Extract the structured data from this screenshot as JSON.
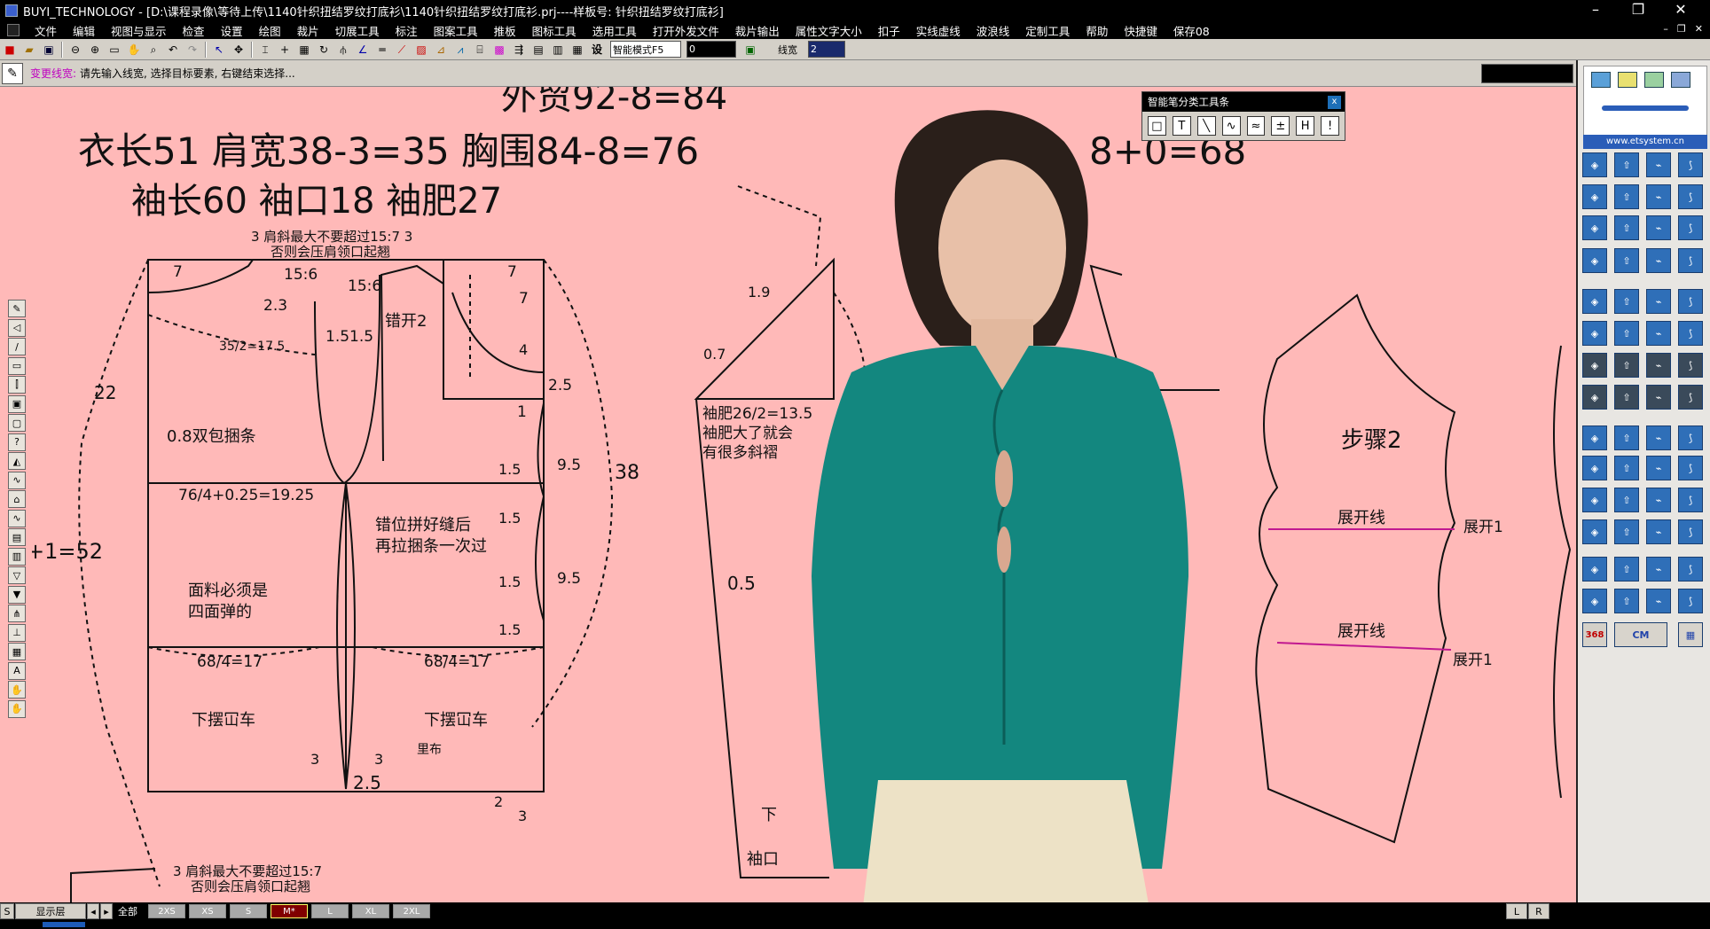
{
  "window": {
    "title": "BUYI_TECHNOLOGY - [D:\\课程录像\\等待上传\\1140针织扭结罗纹打底衫\\1140针织扭结罗纹打底衫.prj----样板号: 针织扭结罗纹打底衫]",
    "controls": {
      "minimize": "–",
      "maximize": "❐",
      "close": "✕"
    }
  },
  "menu": {
    "items": [
      "文件",
      "编辑",
      "视图与显示",
      "检查",
      "设置",
      "绘图",
      "裁片",
      "切展工具",
      "标注",
      "图案工具",
      "推板",
      "图标工具",
      "选用工具",
      "打开外发文件",
      "裁片输出",
      "属性文字大小",
      "扣子",
      "实线虚线",
      "波浪线",
      "定制工具",
      "帮助",
      "快捷键",
      "保存08"
    ],
    "mdi_controls": [
      "–",
      "❐",
      "✕"
    ]
  },
  "toolbar": {
    "mode_select": "智能模式F5",
    "value_input": "0",
    "line_width_label": "线宽",
    "line_width_value": "2"
  },
  "prompt": {
    "command": "变更线宽:",
    "message": "请先输入线宽, 选择目标要素, 右键结束选择..."
  },
  "float_panel": {
    "title": "智能笔分类工具条",
    "close": "x",
    "tools": [
      "□",
      "T",
      "╲",
      "∿",
      "≈",
      "±",
      "H",
      "!"
    ]
  },
  "right_panel": {
    "url": "www.etsystem.cn",
    "badge_368": "368",
    "badge_cm": "CM"
  },
  "status": {
    "s_label": "S",
    "layer_label": "显示层",
    "all_label": "全部",
    "sizes": [
      "2XS",
      "XS",
      "S",
      "M*",
      "L",
      "XL",
      "2XL"
    ],
    "active_size": "M*",
    "l_label": "L",
    "r_label": "R"
  },
  "pattern": {
    "top_cut": "外贸92-8=84",
    "line1": "衣长51   肩宽38-3=35   胸围84-8=76",
    "line1_right": "8+0=68",
    "line2": "袖长60  袖口18   袖肥27",
    "shoulder_note_1": "3  肩斜最大不要超过15:7  3",
    "shoulder_note_2": "否则会压肩领口起翘",
    "n_7a": "7",
    "n_156a": "15:6",
    "n_156b": "15:6",
    "n_7b": "7",
    "n_7c": "7",
    "n_23": "2.3",
    "n_1515": "1.51.5",
    "n_cuo2": "错开2",
    "n_4": "4",
    "n_25a": "2.5",
    "n_35": "35/2=17.5",
    "n_22": "22",
    "n_1": "1",
    "n_08": "0.8双包捆条",
    "n_15a": "1.5",
    "n_95a": "9.5",
    "n_38": "38",
    "n_7625": "76/4+0.25=19.25",
    "n_52": "+1=52",
    "n_cuowei1": "错位拼好缝后",
    "n_cuowei2": "再拉捆条一次过",
    "n_15b": "1.5",
    "n_95b": "9.5",
    "n_15c": "1.5",
    "n_mianliao1": "面料必须是",
    "n_mianliao2": "四面弹的",
    "n_15d": "1.5",
    "n_684a": "68/4=17",
    "n_684b": "68/4=17",
    "n_xiabai1": "下摆冚车",
    "n_xiabai2": "下摆冚车",
    "n_libu": "里布",
    "n_3a": "3",
    "n_3b": "3",
    "n_25b": "2.5",
    "n_2": "2",
    "n_3c": "3",
    "n_19": "1.9",
    "n_07": "0.7",
    "n_xiufei1": "袖肥26/2=13.5",
    "n_xiufei2": "袖肥大了就会",
    "n_xiufei3": "有很多斜褶",
    "n_05": "0.5",
    "n_xia": "下",
    "n_xiukou": "袖口",
    "n_buzhou": "步骤2",
    "n_zhankai1": "展开线",
    "n_zhankai2": "展开线",
    "n_zk1": "展开1",
    "n_zk2": "展开1",
    "n_xian": "线",
    "bottom_note_1": "3  肩斜最大不要超过15:7",
    "bottom_note_2": "否则会压肩领口起翘"
  }
}
